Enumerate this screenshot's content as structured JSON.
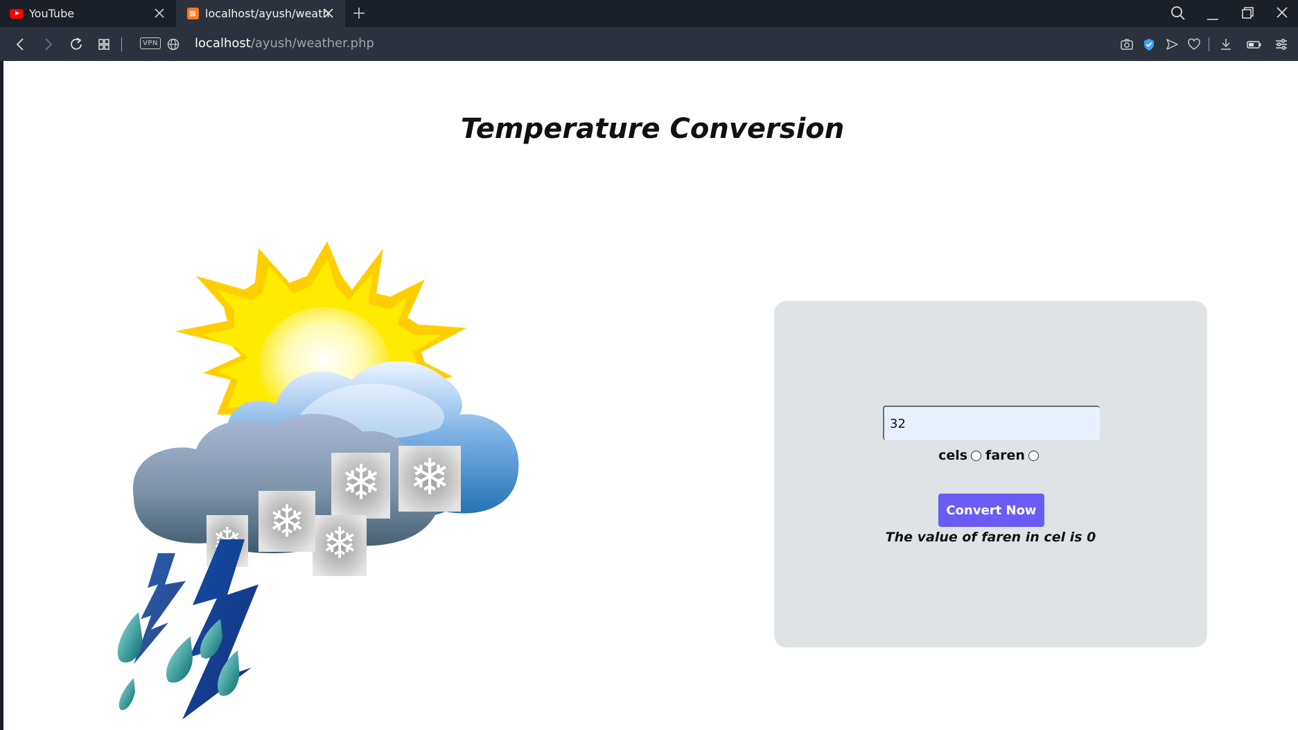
{
  "browser": {
    "tabs": [
      {
        "title": "YouTube",
        "active": false,
        "favicon": "youtube-icon"
      },
      {
        "title": "localhost/ayush/weather.php",
        "active": true,
        "favicon": "xampp-icon"
      }
    ],
    "xampp_mark": "⊠",
    "vpn_label": "VPN",
    "url_host": "localhost",
    "url_path": "/ayush/weather.php",
    "accent_color": "#6a5cf5"
  },
  "page": {
    "title": "Temperature Conversion",
    "input": {
      "value": "32",
      "placeholder": ""
    },
    "options": [
      {
        "label": "cels",
        "checked": false
      },
      {
        "label": "faren",
        "checked": false
      }
    ],
    "convert_label": "Convert Now",
    "result": "The value of faren in cel is 0"
  }
}
